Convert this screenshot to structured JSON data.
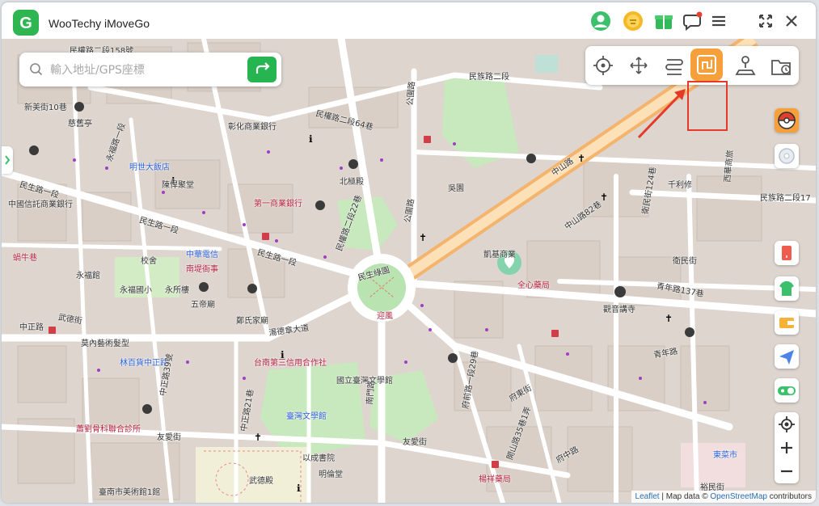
{
  "app": {
    "title": "WooTechy iMoveGo"
  },
  "titlebar": {
    "icons": [
      "avatar-icon",
      "coin-icon",
      "gift-icon",
      "chat-icon",
      "menu-icon",
      "fullscreen-icon",
      "close-icon"
    ]
  },
  "search": {
    "placeholder": "輸入地址/GPS座標",
    "value": ""
  },
  "modes": [
    "teleport-mode",
    "joystick-mode",
    "multi-stop-route",
    "two-spot-route",
    "jump-teleport",
    "history"
  ],
  "active_mode": "two-spot-route",
  "colors": {
    "brand": "#2fb653",
    "accent": "#f6a03b",
    "highlight": "#e53a2a",
    "route": "#f4b46d"
  },
  "map": {
    "labels": [
      {
        "text": "民權路二段158號",
        "cls": ""
      },
      {
        "text": "新美街10巷",
        "cls": ""
      },
      {
        "text": "慈舊亭",
        "cls": ""
      },
      {
        "text": "民權路二段64巷",
        "cls": ""
      },
      {
        "text": "公園路",
        "cls": ""
      },
      {
        "text": "民族路二段",
        "cls": ""
      },
      {
        "text": "彰化商業銀行",
        "cls": ""
      },
      {
        "text": "永福路一段",
        "cls": ""
      },
      {
        "text": "明世大飯店",
        "cls": "blue"
      },
      {
        "text": "陳悍聚堂",
        "cls": ""
      },
      {
        "text": "北極殿",
        "cls": ""
      },
      {
        "text": "吳園",
        "cls": ""
      },
      {
        "text": "中山路",
        "cls": ""
      },
      {
        "text": "中國信託商業銀行",
        "cls": ""
      },
      {
        "text": "民生路一段",
        "cls": ""
      },
      {
        "text": "民生路一段",
        "cls": ""
      },
      {
        "text": "第一商業銀行",
        "cls": "red"
      },
      {
        "text": "民權路二段22巷",
        "cls": ""
      },
      {
        "text": "公園路",
        "cls": ""
      },
      {
        "text": "中山路82巷",
        "cls": ""
      },
      {
        "text": "衛民街124巷",
        "cls": ""
      },
      {
        "text": "千利修",
        "cls": ""
      },
      {
        "text": "西華商旅",
        "cls": ""
      },
      {
        "text": "民族路二段17",
        "cls": ""
      },
      {
        "text": "蝸牛巷",
        "cls": "red"
      },
      {
        "text": "校舍",
        "cls": ""
      },
      {
        "text": "中華電信",
        "cls": "blue"
      },
      {
        "text": "南堤衙事",
        "cls": "red"
      },
      {
        "text": "民生路一段",
        "cls": ""
      },
      {
        "text": "民生綠園",
        "cls": ""
      },
      {
        "text": "凱基商業",
        "cls": ""
      },
      {
        "text": "衛民街",
        "cls": ""
      },
      {
        "text": "永福館",
        "cls": ""
      },
      {
        "text": "永福國小",
        "cls": ""
      },
      {
        "text": "永所樓",
        "cls": ""
      },
      {
        "text": "五帝廟",
        "cls": ""
      },
      {
        "text": "鄭氏家廟",
        "cls": ""
      },
      {
        "text": "迎風",
        "cls": "red"
      },
      {
        "text": "全心藥局",
        "cls": "red"
      },
      {
        "text": "觀音講寺",
        "cls": ""
      },
      {
        "text": "青年路137巷",
        "cls": ""
      },
      {
        "text": "中正路",
        "cls": ""
      },
      {
        "text": "湯德章大道",
        "cls": ""
      },
      {
        "text": "莫內藝術髮型",
        "cls": ""
      },
      {
        "text": "林百貨中正路",
        "cls": "blue"
      },
      {
        "text": "台南第三信用合作社",
        "cls": "red"
      },
      {
        "text": "國立臺灣文學館",
        "cls": ""
      },
      {
        "text": "青年路",
        "cls": ""
      },
      {
        "text": "武德街",
        "cls": ""
      },
      {
        "text": "中正路39號",
        "cls": ""
      },
      {
        "text": "中正路21巷",
        "cls": ""
      },
      {
        "text": "臺灣文學館",
        "cls": "blue"
      },
      {
        "text": "南門路",
        "cls": ""
      },
      {
        "text": "府前路一段29巷",
        "cls": ""
      },
      {
        "text": "開山路35巷1弄",
        "cls": ""
      },
      {
        "text": "府中路",
        "cls": ""
      },
      {
        "text": "蕭劉骨科聯合診所",
        "cls": "red"
      },
      {
        "text": "友愛街",
        "cls": ""
      },
      {
        "text": "友愛街",
        "cls": ""
      },
      {
        "text": "以成書院",
        "cls": ""
      },
      {
        "text": "明倫堂",
        "cls": ""
      },
      {
        "text": "武德殿",
        "cls": ""
      },
      {
        "text": "臺南市美術館1館",
        "cls": ""
      },
      {
        "text": "楊祥藥局",
        "cls": "red"
      },
      {
        "text": "東菜市",
        "cls": "blue"
      },
      {
        "text": "府東街",
        "cls": ""
      },
      {
        "text": "裕民街",
        "cls": ""
      }
    ],
    "attribution": {
      "leaflet": "Leaflet",
      "sep": " | Map data © ",
      "osm": "OpenStreetMap",
      "suffix": " contributors"
    }
  }
}
